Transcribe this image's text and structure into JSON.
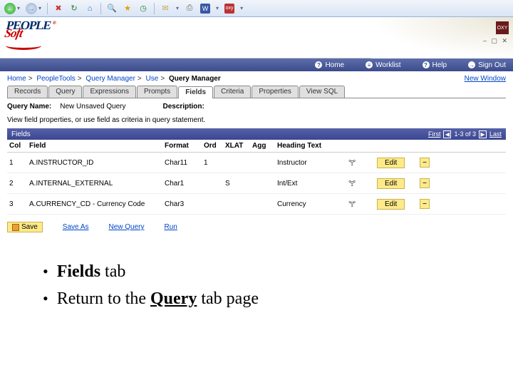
{
  "ie_toolbar": {
    "word_label": "W",
    "oxy_label": "oxy"
  },
  "logo": {
    "line1": "PEOPLE",
    "line2": "Soft",
    "reg": "®",
    "oxy": "OXY",
    "win_controls": "– ▢ ✕"
  },
  "bluebar": [
    {
      "icon": "?",
      "label": "Home"
    },
    {
      "icon": "≡",
      "label": "Worklist"
    },
    {
      "icon": "?",
      "label": "Help"
    },
    {
      "icon": "→",
      "label": "Sign Out"
    }
  ],
  "crumbs": [
    {
      "text": "Home"
    },
    {
      "text": "PeopleTools"
    },
    {
      "text": "Query Manager"
    },
    {
      "text": "Use"
    }
  ],
  "crumb_current": "Query Manager",
  "new_window": "New Window",
  "tabs": [
    "Records",
    "Query",
    "Expressions",
    "Prompts",
    "Fields",
    "Criteria",
    "Properties",
    "View SQL"
  ],
  "active_tab": 4,
  "qname_label": "Query Name:",
  "qname_value": "New Unsaved Query",
  "desc_label": "Description:",
  "instr": "View field properties, or use field as criteria in query statement.",
  "grid_title": "Fields",
  "grid_nav": {
    "first": "First",
    "range": "1-3 of 3",
    "last": "Last"
  },
  "headers": [
    "Col",
    "Field",
    "Format",
    "Ord",
    "XLAT",
    "Agg",
    "Heading Text",
    "",
    "",
    ""
  ],
  "rows": [
    {
      "col": "1",
      "field": "A.INSTRUCTOR_ID",
      "format": "Char11",
      "ord": "1",
      "xlat": "",
      "agg": "",
      "heading": "Instructor",
      "edit": "Edit"
    },
    {
      "col": "2",
      "field": "A.INTERNAL_EXTERNAL",
      "format": "Char1",
      "ord": "",
      "xlat": "S",
      "agg": "",
      "heading": "Int/Ext",
      "edit": "Edit"
    },
    {
      "col": "3",
      "field": "A.CURRENCY_CD - Currency Code",
      "format": "Char3",
      "ord": "",
      "xlat": "",
      "agg": "",
      "heading": "Currency",
      "edit": "Edit"
    }
  ],
  "actions": {
    "save": "Save",
    "saveas": "Save As",
    "newquery": "New Query",
    "run": "Run"
  },
  "bullets": {
    "b1_bold": "Fields",
    "b1_rest": " tab",
    "b2_pre": "Return to the ",
    "b2_bold": "Query",
    "b2_post": " tab page"
  }
}
